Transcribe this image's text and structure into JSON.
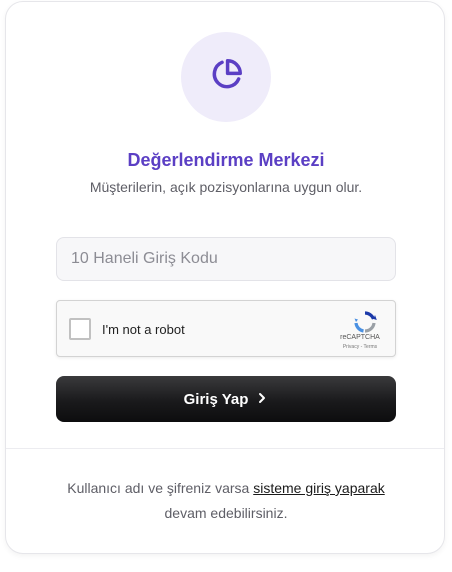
{
  "header": {
    "logo_icon": "pie-chart-icon",
    "accent_color": "#5b3fc4",
    "title": "Değerlendirme Merkezi",
    "subtitle": "Müşterilerin, açık pozisyonlarına uygun olur."
  },
  "form": {
    "code_placeholder": "10 Haneli Giriş Kodu",
    "code_value": "",
    "captcha_label": "I'm not a robot",
    "captcha_brand": "reCAPTCHA",
    "captcha_links": "Privacy - Terms",
    "submit_label": "Giriş Yap",
    "submit_icon": "chevron-right-icon"
  },
  "footer": {
    "text_before": "Kullanıcı adı ve şifreniz varsa ",
    "link_text": "sisteme giriş yaparak",
    "text_after": " devam edebilirsiniz."
  }
}
